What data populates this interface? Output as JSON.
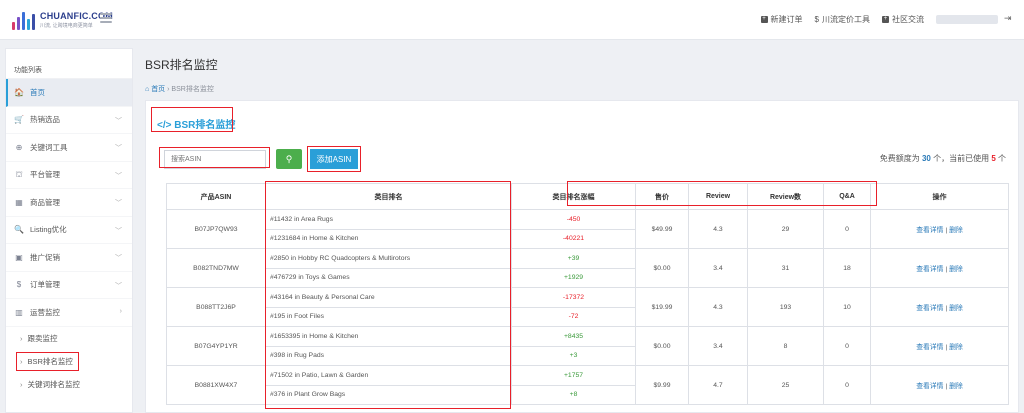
{
  "brand": {
    "name": "CHUANFIC.COM",
    "tagline": "川流, 让跨境电商更简单"
  },
  "topnav": {
    "new_order": "新建订单",
    "pricing_tool": "川流定价工具",
    "community": "社区交流"
  },
  "sidebar": {
    "title": "功能列表",
    "items": [
      {
        "label": "首页",
        "icon": "home-icon",
        "glyph": "🏠"
      },
      {
        "label": "热销选品",
        "icon": "cart-icon",
        "glyph": "🛒"
      },
      {
        "label": "关键词工具",
        "icon": "magnifier-icon",
        "glyph": "⊕"
      },
      {
        "label": "平台管理",
        "icon": "binoculars-icon",
        "glyph": "⛫"
      },
      {
        "label": "商品管理",
        "icon": "grid-icon",
        "glyph": "▦"
      },
      {
        "label": "Listing优化",
        "icon": "search-icon",
        "glyph": "🔍"
      },
      {
        "label": "推广促销",
        "icon": "briefcase-icon",
        "glyph": "▣"
      },
      {
        "label": "订单管理",
        "icon": "dollar-icon",
        "glyph": "$"
      },
      {
        "label": "运营监控",
        "icon": "bar-chart-icon",
        "glyph": "▥"
      }
    ],
    "subitems": [
      {
        "label": "跟卖监控"
      },
      {
        "label": "BSR排名监控"
      },
      {
        "label": "关键词排名监控"
      }
    ]
  },
  "page": {
    "title": "BSR排名监控",
    "breadcrumb_home": "首页",
    "breadcrumb_current": "BSR排名监控",
    "section_title": "BSR排名监控"
  },
  "toolbar": {
    "search_placeholder": "搜索ASIN",
    "add_label": "添加ASIN",
    "quota_prefix": "免费额度为",
    "quota_total": "30",
    "quota_mid": "个，当前已使用",
    "quota_used": "5",
    "quota_suffix": "个"
  },
  "table": {
    "headers": [
      "产品ASIN",
      "类目排名",
      "类目排名涨幅",
      "售价",
      "Review",
      "Review数",
      "Q&A",
      "操作"
    ],
    "op_detail": "查看详情",
    "op_sep": "|",
    "op_delete": "删除",
    "rows": [
      {
        "asin": "B07JP7QW93",
        "price": "$49.99",
        "review": "4.3",
        "review_count": "29",
        "qa": "0",
        "ranks": [
          {
            "cat": "#11432 in Area Rugs",
            "change": "-450",
            "dir": "down"
          },
          {
            "cat": "#1231684 in Home & Kitchen",
            "change": "-40221",
            "dir": "down"
          }
        ]
      },
      {
        "asin": "B082TND7MW",
        "price": "$0.00",
        "review": "3.4",
        "review_count": "31",
        "qa": "18",
        "ranks": [
          {
            "cat": "#2850 in Hobby RC Quadcopters & Multirotors",
            "change": "+39",
            "dir": "up"
          },
          {
            "cat": "#476729 in Toys & Games",
            "change": "+1929",
            "dir": "up"
          }
        ]
      },
      {
        "asin": "B088TT2J6P",
        "price": "$19.99",
        "review": "4.3",
        "review_count": "193",
        "qa": "10",
        "ranks": [
          {
            "cat": "#43164 in Beauty & Personal Care",
            "change": "-17372",
            "dir": "down"
          },
          {
            "cat": "#195 in Foot Files",
            "change": "-72",
            "dir": "down"
          }
        ]
      },
      {
        "asin": "B07G4YP1YR",
        "price": "$0.00",
        "review": "3.4",
        "review_count": "8",
        "qa": "0",
        "ranks": [
          {
            "cat": "#1653395 in Home & Kitchen",
            "change": "+8435",
            "dir": "up"
          },
          {
            "cat": "#398 in Rug Pads",
            "change": "+3",
            "dir": "up"
          }
        ]
      },
      {
        "asin": "B0881XW4X7",
        "price": "$9.99",
        "review": "4.7",
        "review_count": "25",
        "qa": "0",
        "ranks": [
          {
            "cat": "#71502 in Patio, Lawn & Garden",
            "change": "+1757",
            "dir": "up"
          },
          {
            "cat": "#376 in Plant Grow Bags",
            "change": "+8",
            "dir": "up"
          }
        ]
      }
    ]
  },
  "colors": {
    "accent": "#2a9fd8",
    "link": "#2a7ab8",
    "up": "#3a9a3a",
    "down": "#e8202a",
    "highlight_box": "#e8202a"
  }
}
